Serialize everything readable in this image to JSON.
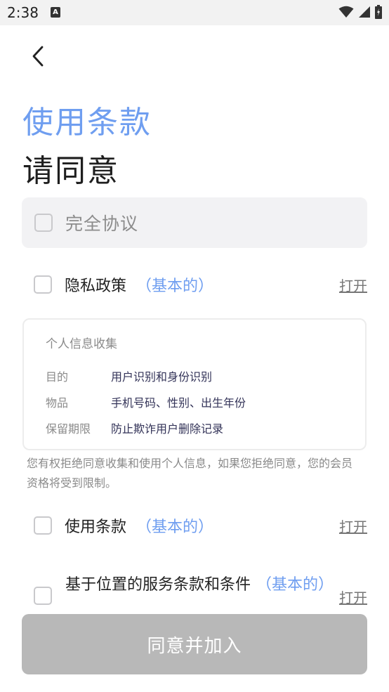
{
  "status_bar": {
    "time": "2:38",
    "notification_letter": "A"
  },
  "header": {
    "title_blue": "使用条款",
    "title_dark": "请同意"
  },
  "agree_all": {
    "label": "完全协议"
  },
  "items": [
    {
      "label": "隐私政策",
      "tag": "（基本的）",
      "link": "打开"
    },
    {
      "label": "使用条款",
      "tag": "（基本的）",
      "link": "打开"
    },
    {
      "label": "基于位置的服务条款和条件",
      "tag": "（基本的）",
      "link": "打开"
    }
  ],
  "info": {
    "title": "个人信息收集",
    "rows": [
      {
        "key": "目的",
        "value": "用户识别和身份识别"
      },
      {
        "key": "物品",
        "value": "手机号码、性别、出生年份"
      },
      {
        "key": "保留期限",
        "value": "防止欺诈用户删除记录"
      }
    ]
  },
  "notice": "您有权拒绝同意收集和使用个人信息，如果您拒绝同意，您的会员资格将受到限制。",
  "join_button": "同意并加入"
}
